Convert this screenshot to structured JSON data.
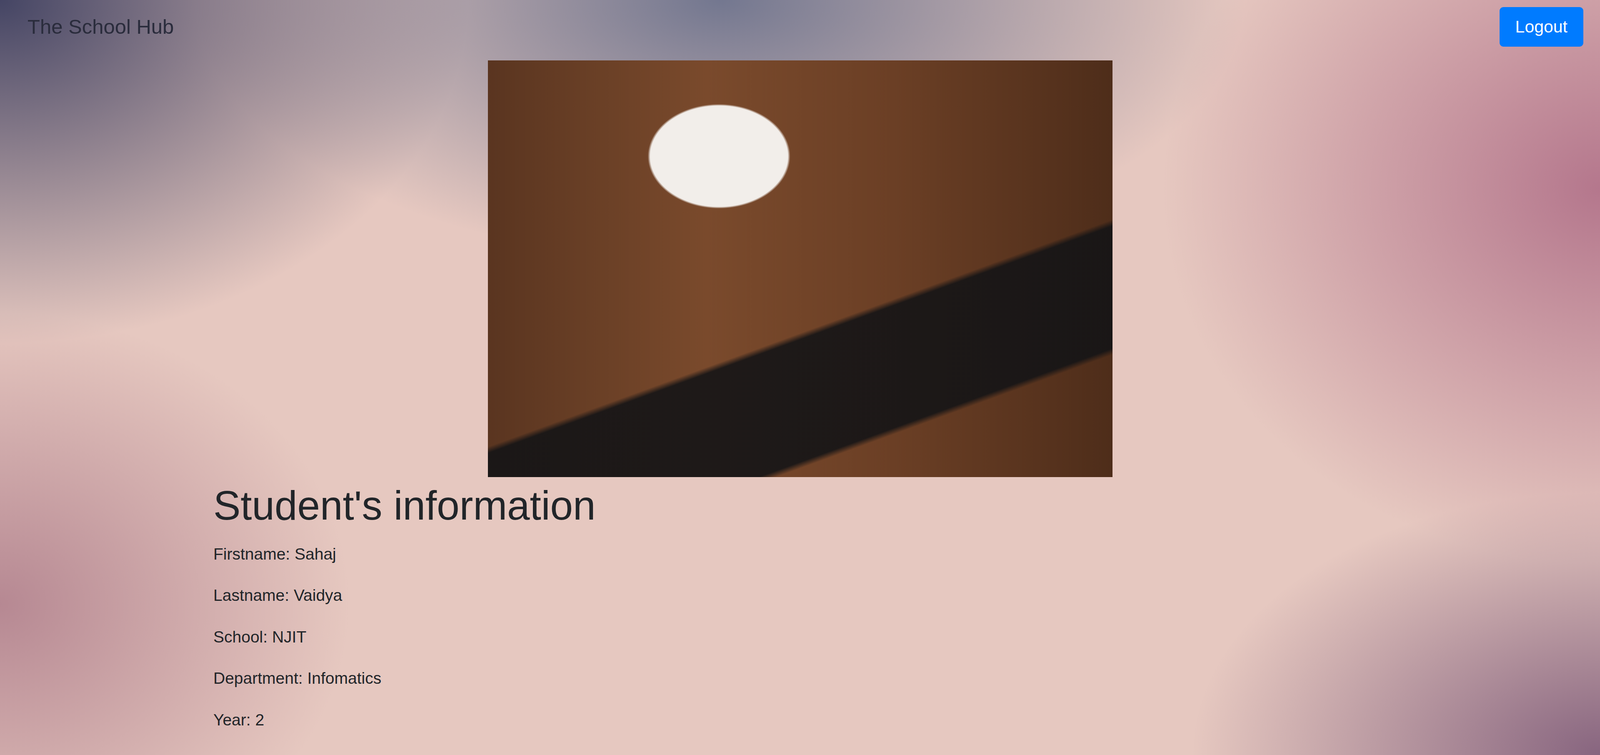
{
  "navbar": {
    "brand": "The School Hub",
    "button": "Logout"
  },
  "heading": "Student's information",
  "fields": [
    "Firstname: Sahaj",
    "Lastname: Vaidya",
    "School: NJIT",
    "Department: Infomatics",
    "Year: 2"
  ]
}
